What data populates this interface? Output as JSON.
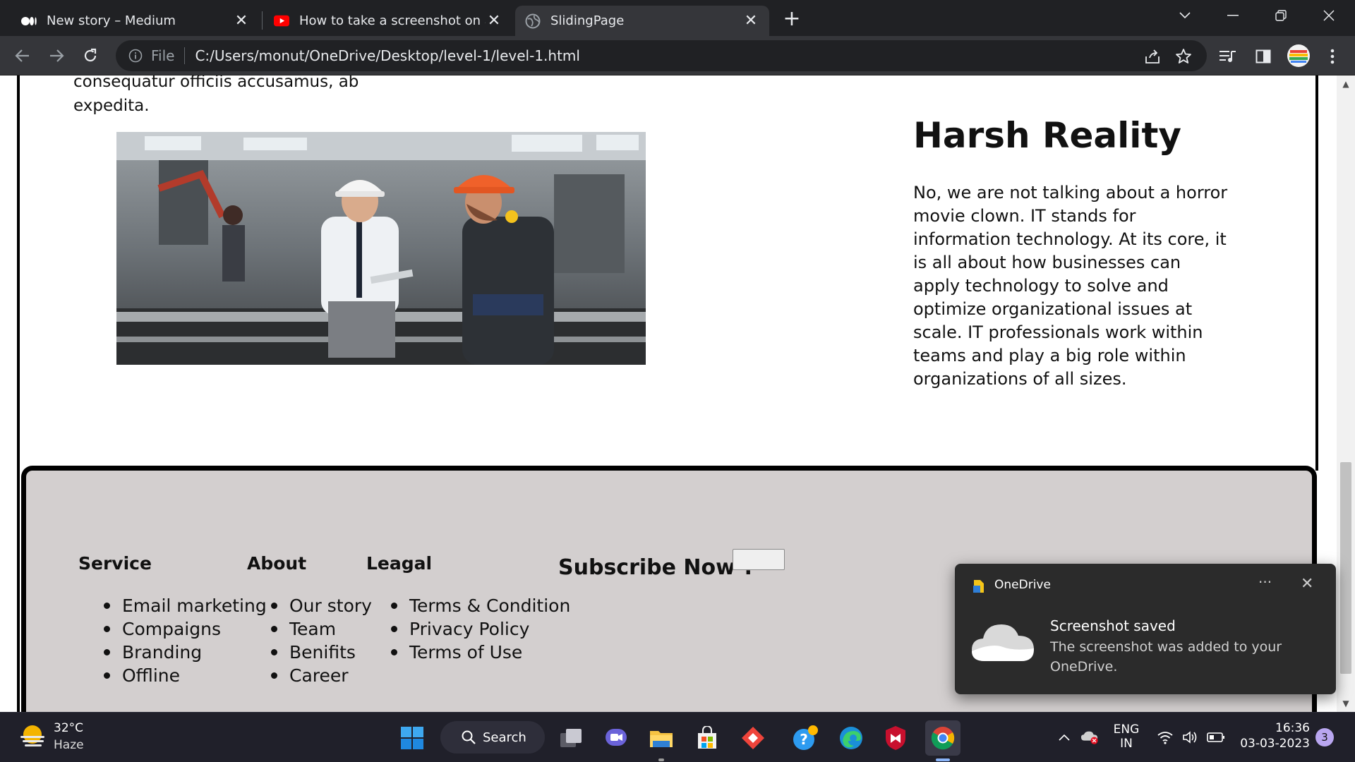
{
  "browser": {
    "tabs": [
      {
        "title": "New story – Medium",
        "active": false
      },
      {
        "title": "How to take a screenshot on a PC",
        "active": false
      },
      {
        "title": "SlidingPage",
        "active": true
      }
    ],
    "address": {
      "scheme": "File",
      "url": "C:/Users/monut/OneDrive/Desktop/level-1/level-1.html"
    }
  },
  "page": {
    "intro_text_line1": "consequatur officiis accusamus, ab",
    "intro_text_line2": "expedita.",
    "heading": "Harsh Reality",
    "paragraph": "No, we are not talking about a horror movie clown. IT stands for information technology. At its core, it is all about how businesses can apply technology to solve and optimize organizational issues at scale. IT professionals work within teams and play a big role within organizations of all sizes.",
    "footer": {
      "columns": [
        {
          "heading": "Service",
          "items": [
            "Email marketing",
            "Compaigns",
            "Branding",
            "Offline"
          ]
        },
        {
          "heading": "About",
          "items": [
            "Our story",
            "Team",
            "Benifits",
            "Career"
          ]
        },
        {
          "heading": "Leagal",
          "items": [
            "Terms & Condition",
            "Privacy Policy",
            "Terms of Use"
          ]
        }
      ],
      "subscribe_label": "Subscribe Now-:",
      "subscribe_value": ""
    }
  },
  "toast": {
    "app": "OneDrive",
    "more": "···",
    "title": "Screenshot saved",
    "body": "The screenshot was added to your OneDrive."
  },
  "taskbar": {
    "weather": {
      "temp": "32°C",
      "condition": "Haze"
    },
    "search_label": "Search",
    "language": {
      "line1": "ENG",
      "line2": "IN"
    },
    "clock": {
      "time": "16:36",
      "date": "03-03-2023"
    },
    "notification_count": "3"
  }
}
